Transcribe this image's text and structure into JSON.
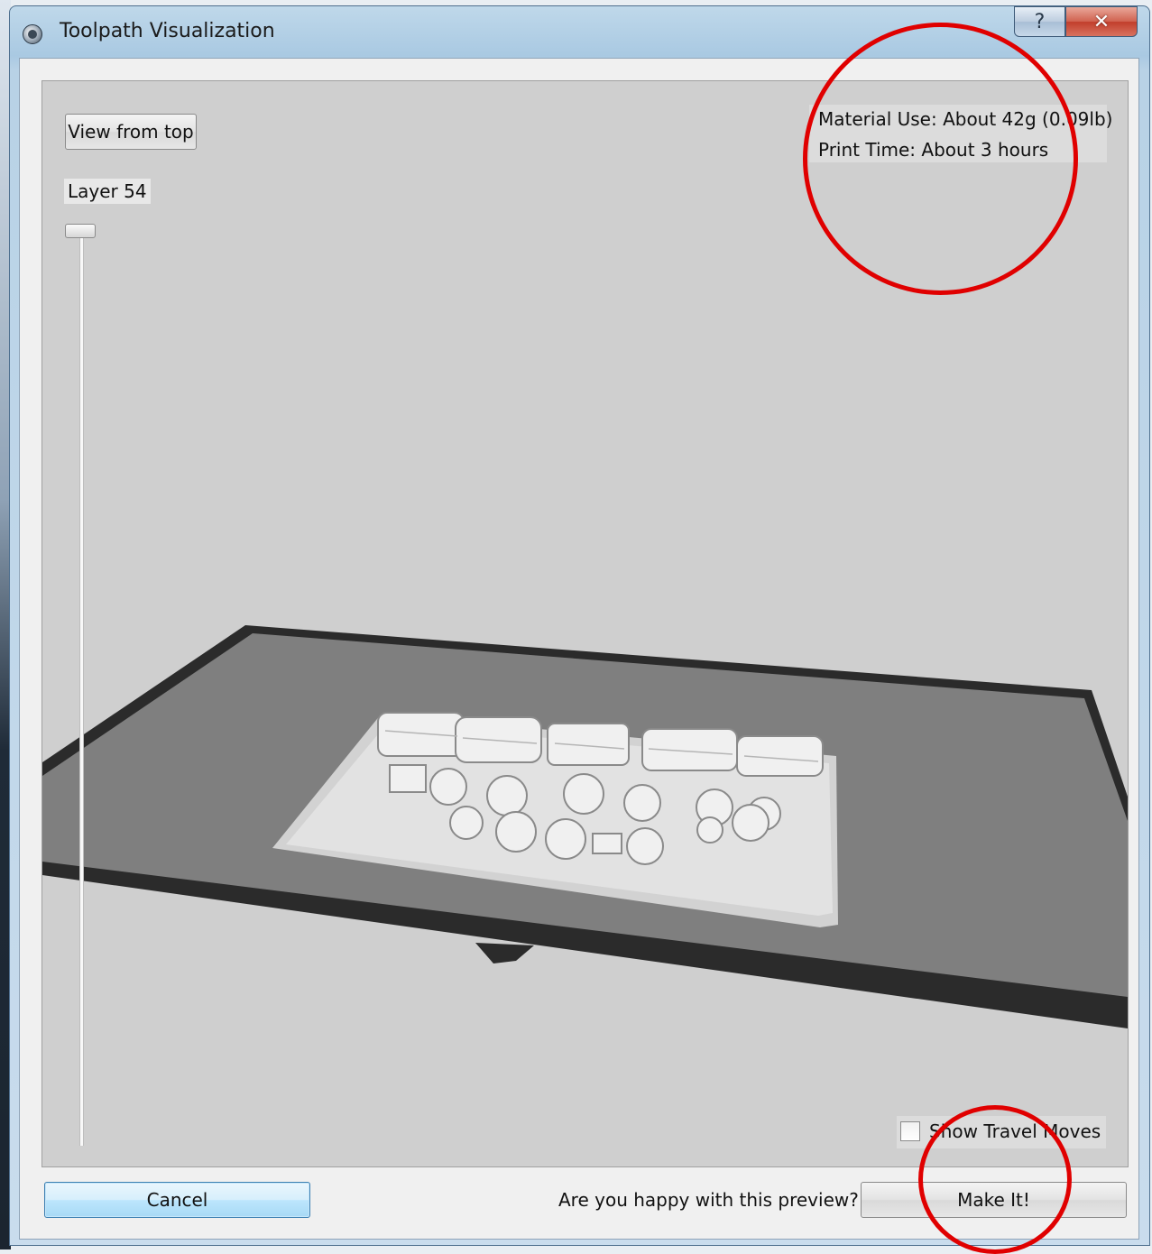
{
  "window": {
    "title": "Toolpath Visualization",
    "help_glyph": "?",
    "close_glyph": "✕"
  },
  "toolbar": {
    "view_from_top_label": "View from top",
    "layer_label": "Layer 54"
  },
  "stats": {
    "material_use": "Material Use: About 42g (0.09lb)",
    "print_time": "Print Time: About 3 hours"
  },
  "options": {
    "show_travel_moves_label": "Show Travel Moves",
    "show_travel_moves_checked": false
  },
  "footer": {
    "cancel_label": "Cancel",
    "prompt": "Are you happy with this preview?",
    "make_it_label": "Make It!"
  },
  "colors": {
    "viewport_bg": "#cfcfcf",
    "platform_top": "#7f7f7f",
    "platform_edge": "#2b2b2b",
    "model": "#e2e2e2",
    "annotation_ring": "#e00000"
  },
  "icons": [
    "makerbot-app-icon",
    "help-icon",
    "close-icon"
  ]
}
